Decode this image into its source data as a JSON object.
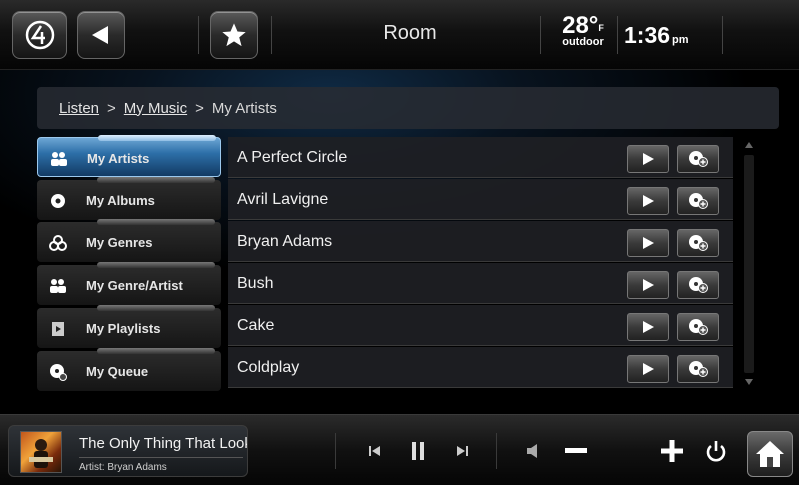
{
  "header": {
    "room": "Room",
    "temperature": "28",
    "temperature_unit": "F",
    "temperature_label": "outdoor",
    "time": "1:36",
    "ampm": "pm"
  },
  "breadcrumb": [
    "Listen",
    ">",
    "My Music",
    ">",
    "My Artists"
  ],
  "sidebar": {
    "items": [
      {
        "label": "My Artists",
        "icon": "people-icon",
        "active": true
      },
      {
        "label": "My Albums",
        "icon": "disc-icon",
        "active": false
      },
      {
        "label": "My Genres",
        "icon": "genres-icon",
        "active": false
      },
      {
        "label": "My Genre/Artist",
        "icon": "people-icon",
        "active": false
      },
      {
        "label": "My Playlists",
        "icon": "playlist-icon",
        "active": false
      },
      {
        "label": "My Queue",
        "icon": "queue-icon",
        "active": false
      }
    ]
  },
  "artists": [
    "A Perfect Circle",
    "Avril Lavigne",
    "Bryan Adams",
    "Bush",
    "Cake",
    "Coldplay"
  ],
  "now_playing": {
    "title": "The Only Thing That Look",
    "artist": "Artist: Bryan Adams"
  },
  "colors": {
    "active_blue": "#2d6fa8",
    "background": "#000000"
  }
}
